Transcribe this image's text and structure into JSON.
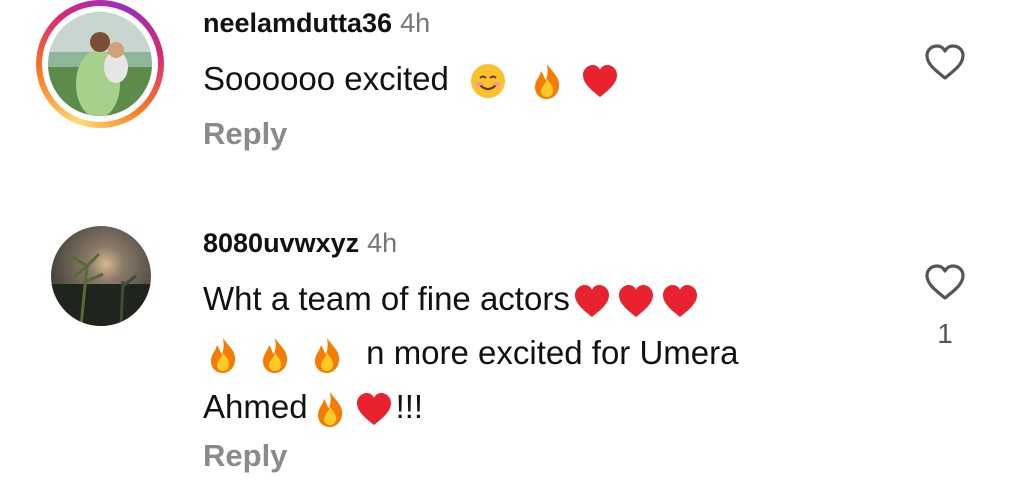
{
  "comments": [
    {
      "username": "neelamdutta36",
      "time": "4h",
      "text": "Soooooo excited",
      "reply_label": "Reply",
      "like_icon": "heart-outline-icon",
      "emojis": [
        "smiling-face-icon",
        "fire-icon",
        "red-heart-icon"
      ]
    },
    {
      "username": "8080uvwxyz",
      "time": "4h",
      "line1": "Wht a team of fine actors",
      "line2": "n more excited for Umera",
      "line3_text": "Ahmed",
      "line3_suffix": "!!!",
      "reply_label": "Reply",
      "like_icon": "heart-outline-icon",
      "like_count": "1"
    }
  ],
  "colors": {
    "reply": "#8a8a8a",
    "time": "#777777",
    "heart": "#e8222e",
    "fire": "#f57c00"
  }
}
